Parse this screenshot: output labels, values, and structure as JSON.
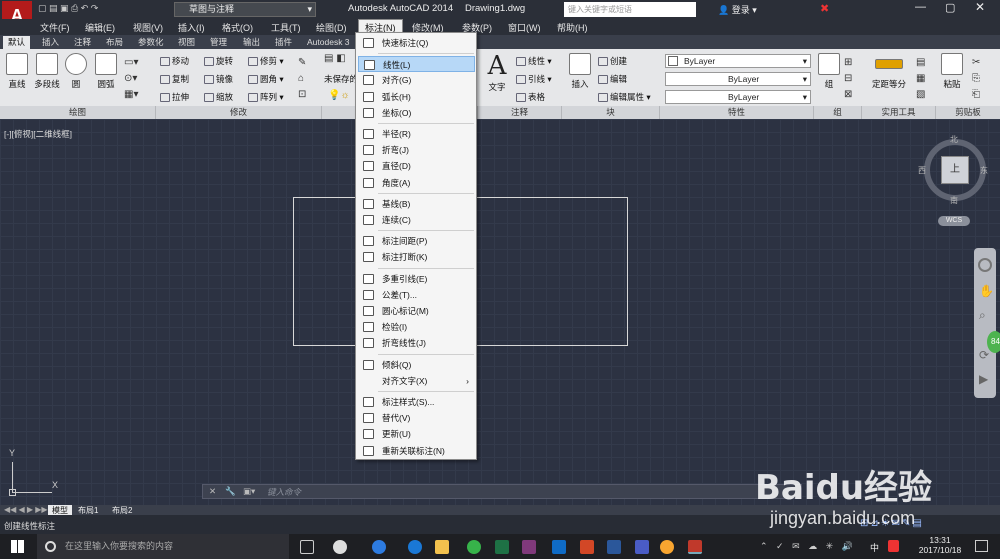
{
  "titlebar": {
    "workspace": "草图与注释",
    "app_title": "Autodesk AutoCAD 2014",
    "file": "Drawing1.dwg",
    "search_placeholder": "键入关键字或短语",
    "login": "登录"
  },
  "menubar": [
    "文件(F)",
    "编辑(E)",
    "视图(V)",
    "插入(I)",
    "格式(O)",
    "工具(T)",
    "绘图(D)",
    "标注(N)",
    "修改(M)",
    "参数(P)",
    "窗口(W)",
    "帮助(H)"
  ],
  "tabs": [
    "默认",
    "插入",
    "注释",
    "布局",
    "参数化",
    "视图",
    "管理",
    "输出",
    "插件",
    "Autodesk 3"
  ],
  "ribbon": {
    "draw": {
      "title": "绘图",
      "line": "直线",
      "polyline": "多段线",
      "circle": "圆",
      "arc": "圆弧"
    },
    "modify": {
      "title": "修改",
      "move": "移动",
      "rotate": "旋转",
      "trim": "修剪",
      "copy": "复制",
      "mirror": "镜像",
      "fillet": "圆角",
      "stretch": "拉伸",
      "scale": "缩放",
      "array": "阵列"
    },
    "layer": {
      "unsaved": "未保存的"
    },
    "annotation": {
      "title": "注释",
      "text": "文字",
      "linear": "线性",
      "leader": "引线",
      "table": "表格"
    },
    "block": {
      "title": "块",
      "insert": "插入",
      "create": "创建",
      "edit": "编辑",
      "edit_attr": "编辑属性"
    },
    "properties": {
      "title": "特性",
      "bylayer1": "ByLayer",
      "bylayer2": "ByLayer",
      "bylayer3": "ByLayer"
    },
    "groups": {
      "title": "组",
      "group": "组"
    },
    "utilities": {
      "title": "实用工具",
      "measure": "定距等分"
    },
    "clipboard": {
      "title": "剪贴板",
      "paste": "粘贴"
    }
  },
  "viewport_label": "[-][俯视][二维线框]",
  "compass": {
    "north": "北",
    "south": "南",
    "east": "东",
    "west": "西",
    "top": "上",
    "wcs": "WCS"
  },
  "badge": "84",
  "command_placeholder": "键入命令",
  "bottom_tabs": [
    "模型",
    "布局1",
    "布局2"
  ],
  "status_text": "创建线性标注",
  "taskbar": {
    "search": "在这里输入你要搜索的内容",
    "time": "13:31",
    "date": "2017/10/18",
    "ime": "中"
  },
  "watermark": {
    "brand": "Baidu经验",
    "url": "jingyan.baidu.com"
  },
  "menu": [
    {
      "label": "快速标注(Q)",
      "icon": "quick-dim-icon"
    },
    {
      "sep": true
    },
    {
      "label": "线性(L)",
      "icon": "linear-dim-icon",
      "highlight": true
    },
    {
      "label": "对齐(G)",
      "icon": "aligned-dim-icon"
    },
    {
      "label": "弧长(H)",
      "icon": "arc-length-icon"
    },
    {
      "label": "坐标(O)",
      "icon": "ordinate-icon"
    },
    {
      "sep": true
    },
    {
      "label": "半径(R)",
      "icon": "radius-icon"
    },
    {
      "label": "折弯(J)",
      "icon": "jogged-icon"
    },
    {
      "label": "直径(D)",
      "icon": "diameter-icon"
    },
    {
      "label": "角度(A)",
      "icon": "angular-icon"
    },
    {
      "sep": true
    },
    {
      "label": "基线(B)",
      "icon": "baseline-icon"
    },
    {
      "label": "连续(C)",
      "icon": "continue-icon"
    },
    {
      "sep": true
    },
    {
      "label": "标注间距(P)",
      "icon": "dim-space-icon"
    },
    {
      "label": "标注打断(K)",
      "icon": "dim-break-icon"
    },
    {
      "sep": true
    },
    {
      "label": "多重引线(E)",
      "icon": "multileader-icon"
    },
    {
      "label": "公差(T)...",
      "icon": "tolerance-icon"
    },
    {
      "label": "圆心标记(M)",
      "icon": "center-mark-icon"
    },
    {
      "label": "检验(I)",
      "icon": "inspect-icon"
    },
    {
      "label": "折弯线性(J)",
      "icon": "jogged-linear-icon"
    },
    {
      "sep": true
    },
    {
      "label": "倾斜(Q)",
      "icon": "oblique-icon"
    },
    {
      "label": "对齐文字(X)",
      "submenu": true
    },
    {
      "sep": true
    },
    {
      "label": "标注样式(S)...",
      "icon": "dim-style-icon"
    },
    {
      "label": "替代(V)",
      "icon": "override-icon"
    },
    {
      "label": "更新(U)",
      "icon": "update-icon"
    },
    {
      "label": "重新关联标注(N)",
      "icon": "reassociate-icon"
    }
  ]
}
